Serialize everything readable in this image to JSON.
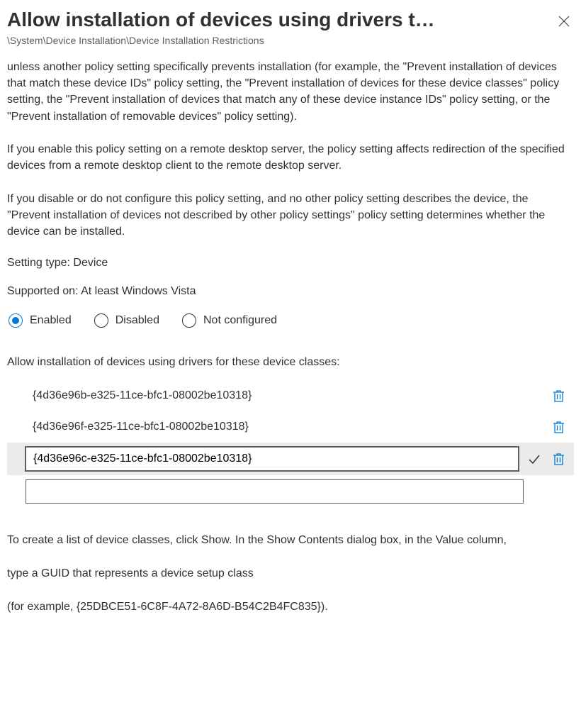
{
  "header": {
    "title": "Allow installation of devices using drivers t…",
    "breadcrumb": "\\System\\Device Installation\\Device Installation Restrictions"
  },
  "description": "unless another policy setting specifically prevents installation (for example, the \"Prevent installation of devices that match these device IDs\" policy setting, the \"Prevent installation of devices for these device classes\" policy setting, the \"Prevent installation of devices that match any of these device instance IDs\" policy setting, or the \"Prevent installation of removable devices\" policy setting).\n\nIf you enable this policy setting on a remote desktop server, the policy setting affects redirection of the specified devices from a remote desktop client to the remote desktop server.\n\nIf you disable or do not configure this policy setting, and no other policy setting describes the device, the \"Prevent installation of devices not described by other policy settings\" policy setting determines whether the device can be installed.",
  "meta": {
    "setting_type": "Setting type: Device",
    "supported_on": "Supported on: At least Windows Vista"
  },
  "state": {
    "options": {
      "enabled": "Enabled",
      "disabled": "Disabled",
      "not_configured": "Not configured"
    },
    "selected": "enabled"
  },
  "list": {
    "label": "Allow installation of devices using drivers for these device classes:",
    "items": [
      {
        "value": "{4d36e96b-e325-11ce-bfc1-08002be10318}"
      },
      {
        "value": "{4d36e96f-e325-11ce-bfc1-08002be10318}"
      }
    ],
    "editing": {
      "value": "{4d36e96c-e325-11ce-bfc1-08002be10318}"
    },
    "new_value": ""
  },
  "help": {
    "p1": "To create a list of device classes, click Show. In the Show Contents dialog box, in the Value column,",
    "p2": "type a GUID that represents a device setup class",
    "p3": "(for example, {25DBCE51-6C8F-4A72-8A6D-B54C2B4FC835})."
  }
}
